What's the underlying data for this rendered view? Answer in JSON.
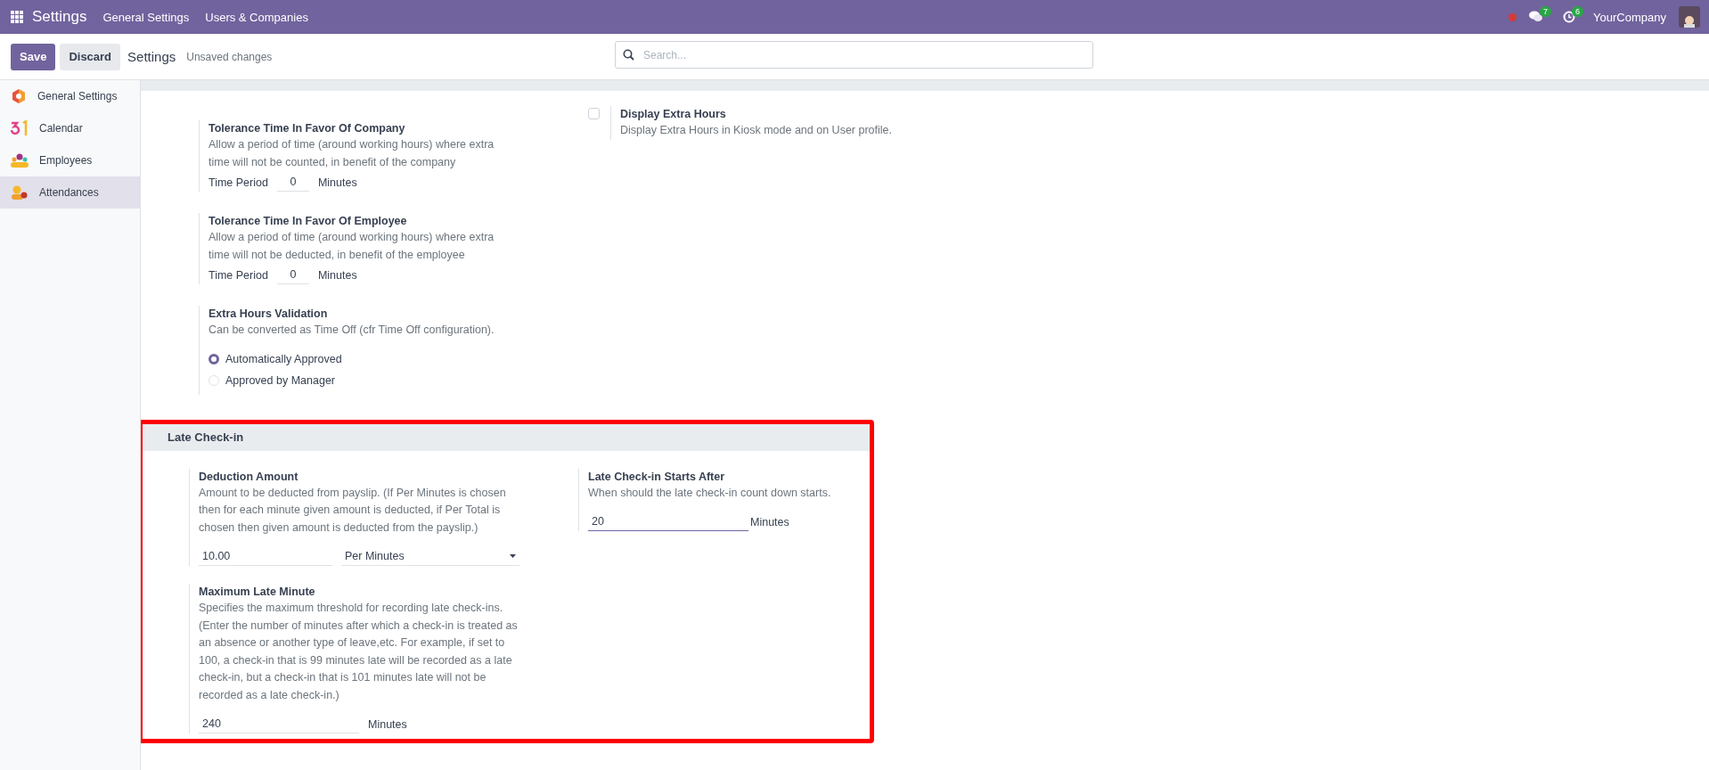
{
  "navbar": {
    "app": "Settings",
    "menu": [
      "General Settings",
      "Users & Companies"
    ],
    "messages_count": "7",
    "activities_count": "6",
    "company": "YourCompany"
  },
  "control_panel": {
    "save": "Save",
    "discard": "Discard",
    "title": "Settings",
    "status": "Unsaved changes",
    "search": {
      "placeholder": "Search..."
    }
  },
  "sidebar": {
    "items": [
      {
        "label": "General Settings",
        "selected": false
      },
      {
        "label": "Calendar",
        "selected": false
      },
      {
        "label": "Employees",
        "selected": false
      },
      {
        "label": "Attendances",
        "selected": true
      }
    ]
  },
  "extra_hours": {
    "settings": [
      {
        "kind": "period",
        "title": "Tolerance Time In Favor Of Company",
        "description": "Allow a period of time (around working hours) where extra time will not be counted, in benefit of the company",
        "field_label": "Time Period",
        "value": "0",
        "unit": "Minutes"
      },
      {
        "kind": "period",
        "title": "Tolerance Time In Favor Of Employee",
        "description": "Allow a period of time (around working hours) where extra time will not be deducted, in benefit of the employee",
        "field_label": "Time Period",
        "value": "0",
        "unit": "Minutes"
      },
      {
        "kind": "radio",
        "title": "Extra Hours Validation",
        "description": "Can be converted as Time Off (cfr Time Off configuration).",
        "options": [
          {
            "label": "Automatically Approved",
            "selected": true
          },
          {
            "label": "Approved by Manager",
            "selected": false
          }
        ]
      }
    ],
    "display": {
      "title": "Display Extra Hours",
      "description": "Display Extra Hours in Kiosk mode and on User profile.",
      "checked": false
    }
  },
  "late_check_in": {
    "title": "Late Check-in",
    "highlighted": true,
    "deduction": {
      "title": "Deduction Amount",
      "description": "Amount to be deducted from payslip. (If Per Minutes is chosen then for each minute given amount is deducted, if Per Total is chosen then given amount is deducted from the payslip.)",
      "amount": "10.00",
      "mode": "Per Minutes"
    },
    "maximum": {
      "title": "Maximum Late Minute",
      "description": "Specifies the maximum threshold for recording late check-ins. (Enter the number of minutes after which a check-in is treated as an absence or another type of leave,etc. For example, if set to 100, a check-in that is 99 minutes late will be recorded as a late check-in, but a check-in that is 101 minutes late will not be recorded as a late check-in.)",
      "value": "240",
      "unit": "Minutes"
    },
    "starts_after": {
      "title": "Late Check-in Starts After",
      "description": "When should the late check-in count down starts.",
      "value": "20",
      "unit": "Minutes",
      "focused": true
    }
  }
}
